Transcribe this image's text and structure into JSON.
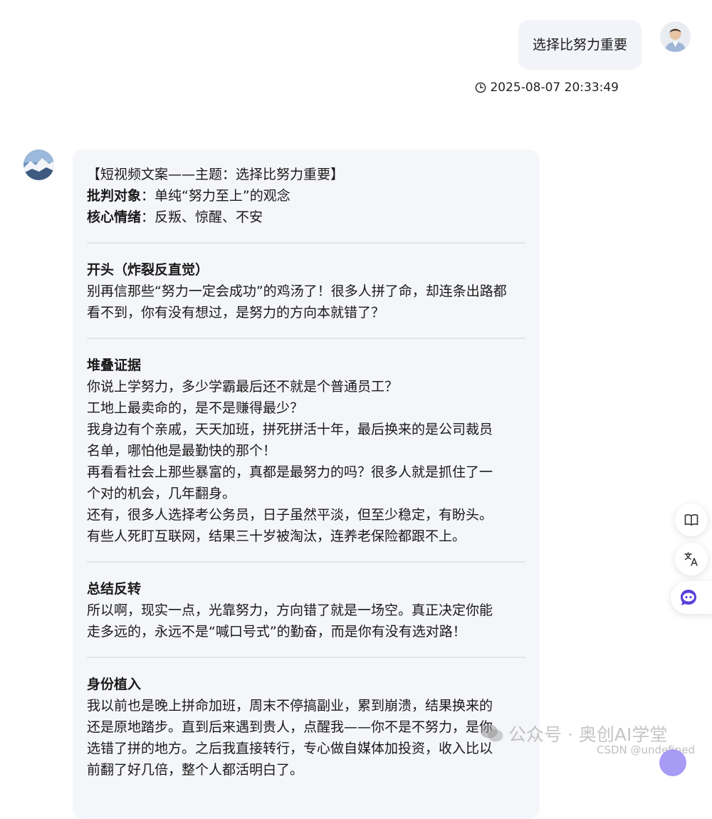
{
  "user_message": {
    "text": "选择比努力重要",
    "timestamp": "2025-08-07 20:33:49"
  },
  "bot_message": {
    "header": {
      "title": "【短视频文案——主题：选择比努力重要】",
      "critique_label": "批判对象",
      "critique_value": "：单纯“努力至上”的观念",
      "emotion_label": "核心情绪",
      "emotion_value": "：反叛、惊醒、不安"
    },
    "sections": [
      {
        "title": "开头（炸裂反直觉）",
        "lines": [
          "别再信那些“努力一定会成功”的鸡汤了！很多人拼了命，却连条出路都",
          "看不到，你有没有想过，是努力的方向本就错了？"
        ]
      },
      {
        "title": "堆叠证据",
        "lines": [
          "你说上学努力，多少学霸最后还不就是个普通员工？",
          "工地上最卖命的，是不是赚得最少？",
          "我身边有个亲戚，天天加班，拼死拼活十年，最后换来的是公司裁员",
          "名单，哪怕他是最勤快的那个！",
          "再看看社会上那些暴富的，真都是最努力的吗？很多人就是抓住了一",
          "个对的机会，几年翻身。",
          "还有，很多人选择考公务员，日子虽然平淡，但至少稳定，有盼头。",
          "有些人死盯互联网，结果三十岁被淘汰，连养老保险都跟不上。"
        ]
      },
      {
        "title": "总结反转",
        "lines": [
          "所以啊，现实一点，光靠努力，方向错了就是一场空。真正决定你能",
          "走多远的，永远不是“喊口号式”的勤奋，而是你有没有选对路！"
        ]
      },
      {
        "title": "身份植入",
        "lines": [
          "我以前也是晚上拼命加班，周末不停搞副业，累到崩溃，结果换来的",
          "还是原地踏步。直到后来遇到贵人，点醒我——你不是不努力，是你",
          "选错了拼的地方。之后我直接转行，专心做自媒体加投资，收入比以",
          "前翻了好几倍，整个人都活明白了。"
        ]
      }
    ]
  },
  "side_toolbar": {
    "icons": [
      "book-icon",
      "translate-icon",
      "assistant-icon"
    ]
  },
  "watermark": {
    "text": "公众号 · 奥创AI学堂",
    "csdn": "CSDN @undefined"
  }
}
